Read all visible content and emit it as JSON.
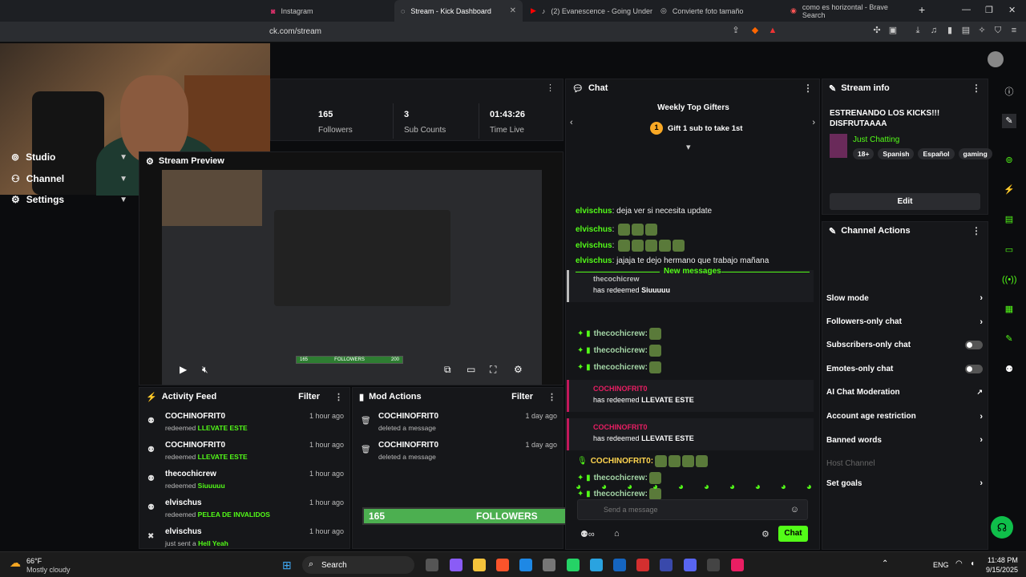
{
  "tabs": [
    {
      "label": "Instagram"
    },
    {
      "label": "Stream - Kick Dashboard"
    },
    {
      "label": "(2) Evanescence - Going Under ("
    },
    {
      "label": "Convierte foto tamaño"
    },
    {
      "label": "como es horizontal - Brave Search"
    }
  ],
  "url": "ck.com/stream",
  "nav": [
    {
      "label": "Studio"
    },
    {
      "label": "Channel"
    },
    {
      "label": "Settings"
    }
  ],
  "stats": [
    {
      "value": "165",
      "label": "Followers"
    },
    {
      "value": "3",
      "label": "Sub Counts"
    },
    {
      "value": "01:43:26",
      "label": "Time Live"
    }
  ],
  "preview": {
    "title": "Stream Preview",
    "overlay_followers": "165",
    "overlay_goal": "200",
    "overlay_label": "FOLLOWERS"
  },
  "activity": {
    "title": "Activity Feed",
    "filter": "Filter",
    "items": [
      {
        "user": "COCHINOFRIT0",
        "action": "redeemed",
        "reward": "LLEVATE ESTE",
        "time": "1 hour ago"
      },
      {
        "user": "COCHINOFRIT0",
        "action": "redeemed",
        "reward": "LLEVATE ESTE",
        "time": "1 hour ago"
      },
      {
        "user": "thecochicrew",
        "action": "redeemed",
        "reward": "Siuuuuu",
        "time": "1 hour ago"
      },
      {
        "user": "elvischus",
        "action": "redeemed",
        "reward": "PELEA DE INVALIDOS",
        "time": "1 hour ago"
      },
      {
        "user": "elvischus",
        "action": "just sent a",
        "reward": "Hell Yeah",
        "time": "1 hour ago"
      }
    ]
  },
  "mod": {
    "title": "Mod Actions",
    "filter": "Filter",
    "items": [
      {
        "user": "COCHINOFRIT0",
        "action": "deleted a message",
        "time": "1 day ago"
      },
      {
        "user": "COCHINOFRIT0",
        "action": "deleted a message",
        "time": "1 day ago"
      }
    ]
  },
  "goal_bar": {
    "current": "165",
    "label": "FOLLOWERS",
    "target": "200",
    "progress": 0.825
  },
  "chat": {
    "title": "Chat",
    "gifters_title": "Weekly Top Gifters",
    "gifters_rank": "1",
    "gifters_text": "Gift 1 sub to take 1st",
    "new_messages": "New messages",
    "placeholder": "Send a message",
    "send_label": "Chat",
    "messages": [
      {
        "user": "elvischus",
        "text": "deja ver si necesita update"
      },
      {
        "user": "elvischus",
        "text": ""
      },
      {
        "user": "elvischus",
        "text": ""
      },
      {
        "user": "elvischus",
        "text": "jajaja te dejo hermano que trabajo mañana"
      }
    ],
    "redeems": [
      {
        "user": "thecochicrew",
        "pre": "has redeemed",
        "reward": "Siuuuuu"
      },
      {
        "user": "COCHINOFRIT0",
        "pre": "has redeemed",
        "reward": "LLEVATE ESTE"
      },
      {
        "user": "COCHINOFRIT0",
        "pre": "has redeemed",
        "reward": "LLEVATE ESTE"
      }
    ],
    "emote_users": [
      "thecochicrew:",
      "thecochicrew:",
      "thecochicrew:",
      "COCHINOFRIT0:",
      "thecochicrew:",
      "thecochicrew:",
      "thecochicrew:"
    ]
  },
  "stream_info": {
    "title": "Stream info",
    "stream_title": "ESTRENANDO LOS KICKS!!! DISFRUTAAAA",
    "category": "Just Chatting",
    "tags": [
      "18+",
      "Spanish",
      "Español",
      "gaming"
    ],
    "edit": "Edit"
  },
  "channel_actions": {
    "title": "Channel Actions",
    "items": [
      {
        "label": "Slow mode",
        "kind": "arrow"
      },
      {
        "label": "Followers-only chat",
        "kind": "arrow"
      },
      {
        "label": "Subscribers-only chat",
        "kind": "toggle"
      },
      {
        "label": "Emotes-only chat",
        "kind": "toggle"
      },
      {
        "label": "AI Chat Moderation",
        "kind": "ext"
      },
      {
        "label": "Account age restriction",
        "kind": "arrow"
      },
      {
        "label": "Banned words",
        "kind": "arrow"
      },
      {
        "label": "Host Channel",
        "kind": "disabled"
      },
      {
        "label": "Set goals",
        "kind": "arrow"
      }
    ]
  },
  "taskbar": {
    "weather_temp": "66°F",
    "weather_desc": "Mostly cloudy",
    "search": "Search",
    "lang": "ENG",
    "time": "11:48 PM",
    "date": "9/15/2025"
  },
  "colors": {
    "accent": "#53fc18",
    "panel": "#16171a",
    "bg": "#0b0c0e"
  }
}
